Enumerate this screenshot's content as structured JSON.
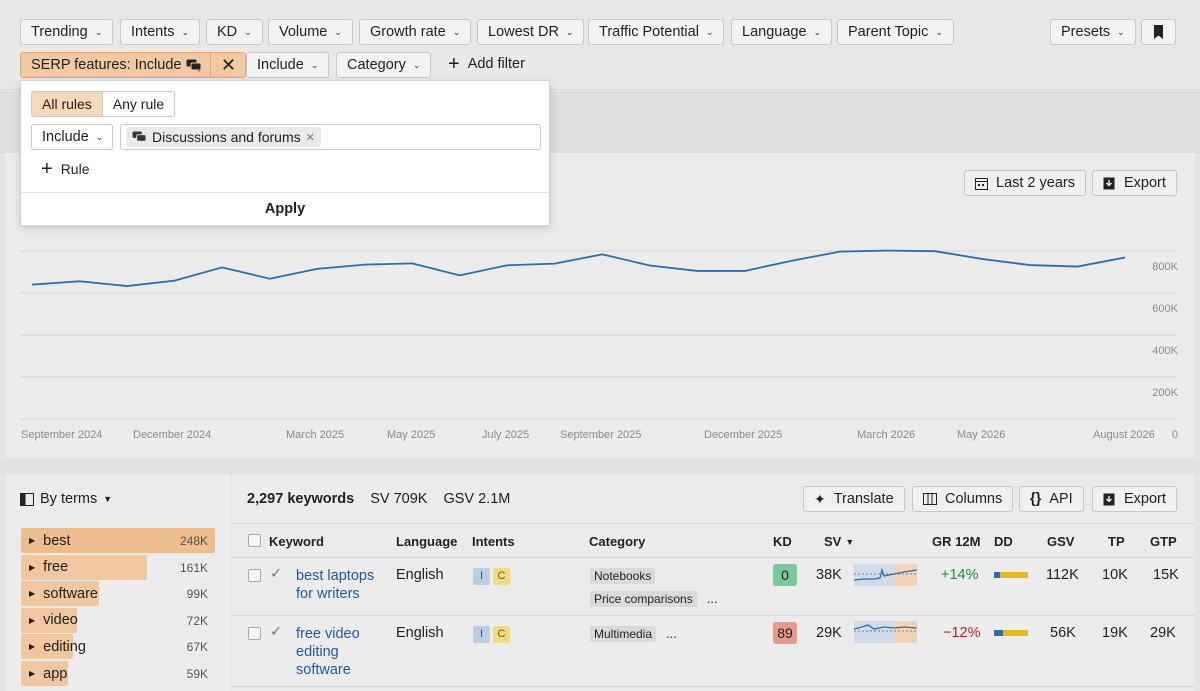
{
  "filters": {
    "row1": [
      "Trending",
      "Intents",
      "KD",
      "Volume",
      "Growth rate",
      "Lowest DR",
      "Traffic Potential",
      "Language",
      "Parent Topic"
    ],
    "presets": "Presets",
    "serp_chip": "SERP features: Include",
    "include": "Include",
    "category": "Category",
    "add_filter": "Add filter"
  },
  "popup": {
    "all_rules": "All rules",
    "any_rule": "Any rule",
    "include": "Include",
    "tag": "Discussions and forums",
    "rule": "Rule",
    "apply": "Apply"
  },
  "chart_header": {
    "range": "Last 2 years",
    "export": "Export"
  },
  "chart_data": {
    "type": "line",
    "x_labels": [
      "September 2024",
      "December 2024",
      "March 2025",
      "May 2025",
      "July 2025",
      "September 2025",
      "December 2025",
      "March 2026",
      "May 2026",
      "August 2026"
    ],
    "y_ticks": [
      "800K",
      "600K",
      "400K",
      "200K",
      "0"
    ],
    "ylim": [
      0,
      800000
    ],
    "grid": true,
    "series": [
      {
        "color": "#2a6db4",
        "values": [
          640000,
          656000,
          633000,
          659000,
          722000,
          668000,
          715000,
          735000,
          741000,
          684000,
          732000,
          740000,
          784000,
          731000,
          705000,
          705000,
          754000,
          797000,
          802000,
          799000,
          762000,
          733000,
          726000,
          769000
        ]
      }
    ]
  },
  "summary": {
    "by_terms": "By terms",
    "keywords": "2,297 keywords",
    "sv": "SV 709K",
    "gsv": "GSV 2.1M",
    "translate": "Translate",
    "columns": "Columns",
    "api": "API",
    "export": "Export"
  },
  "terms": [
    {
      "label": "best",
      "value": "248K",
      "share": 1.0
    },
    {
      "label": "free",
      "value": "161K",
      "share": 0.65
    },
    {
      "label": "software",
      "value": "99K",
      "share": 0.4
    },
    {
      "label": "video",
      "value": "72K",
      "share": 0.29
    },
    {
      "label": "editing",
      "value": "67K",
      "share": 0.27
    },
    {
      "label": "app",
      "value": "59K",
      "share": 0.24
    }
  ],
  "table": {
    "headers": {
      "keyword": "Keyword",
      "language": "Language",
      "intents": "Intents",
      "category": "Category",
      "kd": "KD",
      "sv": "SV",
      "gr": "GR 12M",
      "dd": "DD",
      "gsv": "GSV",
      "tp": "TP",
      "gtp": "GTP"
    },
    "rows": [
      {
        "keyword_l1": "best laptops",
        "keyword_l2": "for writers",
        "keyword_l3": "",
        "language": "English",
        "intents": [
          "I",
          "C"
        ],
        "cat1": "Notebooks",
        "cat2": "Price comparisons",
        "more": "...",
        "kd": "0",
        "sv": "38K",
        "gr": "+14%",
        "gsv": "112K",
        "tp": "10K",
        "gtp": "15K"
      },
      {
        "keyword_l1": "free video",
        "keyword_l2": "editing",
        "keyword_l3": "software",
        "language": "English",
        "intents": [
          "I",
          "C"
        ],
        "cat1": "Multimedia",
        "cat2": "",
        "more": "...",
        "kd": "89",
        "sv": "29K",
        "gr": "−12%",
        "gsv": "56K",
        "tp": "19K",
        "gtp": "29K"
      }
    ]
  }
}
